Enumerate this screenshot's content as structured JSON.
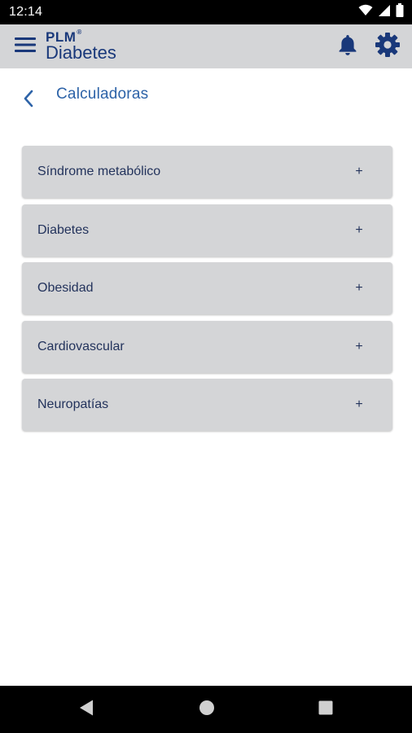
{
  "status_bar": {
    "time": "12:14",
    "icons": [
      "wifi-icon",
      "signal-icon",
      "battery-icon"
    ]
  },
  "app_bar": {
    "logo_brand": "PLM",
    "logo_registered": "®",
    "logo_product": "Diabetes",
    "icons": [
      "menu-icon",
      "bell-icon",
      "gear-icon"
    ]
  },
  "page": {
    "title": "Calculadoras",
    "back_icon": "chevron-left-icon"
  },
  "calculators": [
    {
      "label": "Síndrome metabólico",
      "expand_symbol": "+"
    },
    {
      "label": "Diabetes",
      "expand_symbol": "+"
    },
    {
      "label": "Obesidad",
      "expand_symbol": "+"
    },
    {
      "label": "Cardiovascular",
      "expand_symbol": "+"
    },
    {
      "label": "Neuropatías",
      "expand_symbol": "+"
    }
  ],
  "nav_bar": {
    "icons": [
      "back-triangle-icon",
      "home-circle-icon",
      "recents-square-icon"
    ]
  },
  "colors": {
    "app_bar_bg": "#d4d5d7",
    "brand_blue": "#19387a",
    "title_blue": "#2d63a8",
    "item_bg": "#d4d5d7",
    "item_text": "#23335c"
  }
}
